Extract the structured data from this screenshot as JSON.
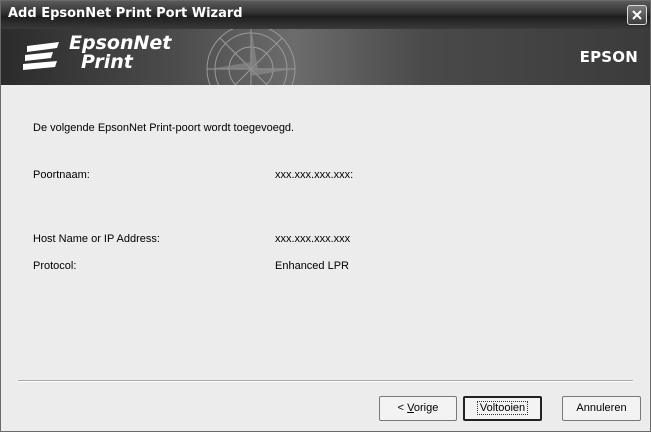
{
  "window": {
    "title": "Add EpsonNet Print Port Wizard"
  },
  "banner": {
    "logo_line1": "EpsonNet",
    "logo_line2": "Print",
    "brand": "EPSON"
  },
  "content": {
    "intro": "De volgende EpsonNet Print-poort wordt toegevoegd.",
    "rows": [
      {
        "label": "Poortnaam:",
        "value": "xxx.xxx.xxx.xxx:"
      },
      {
        "label": "Host Name or IP Address:",
        "value": "xxx.xxx.xxx.xxx"
      },
      {
        "label": "Protocol:",
        "value": "Enhanced LPR"
      }
    ]
  },
  "buttons": {
    "back_accel": "V",
    "back_rest": "orige",
    "finish": "Voltooien",
    "cancel": "Annuleren"
  },
  "icons": [
    "close-icon",
    "epsonnet-logo-icon",
    "compass-graphic"
  ]
}
